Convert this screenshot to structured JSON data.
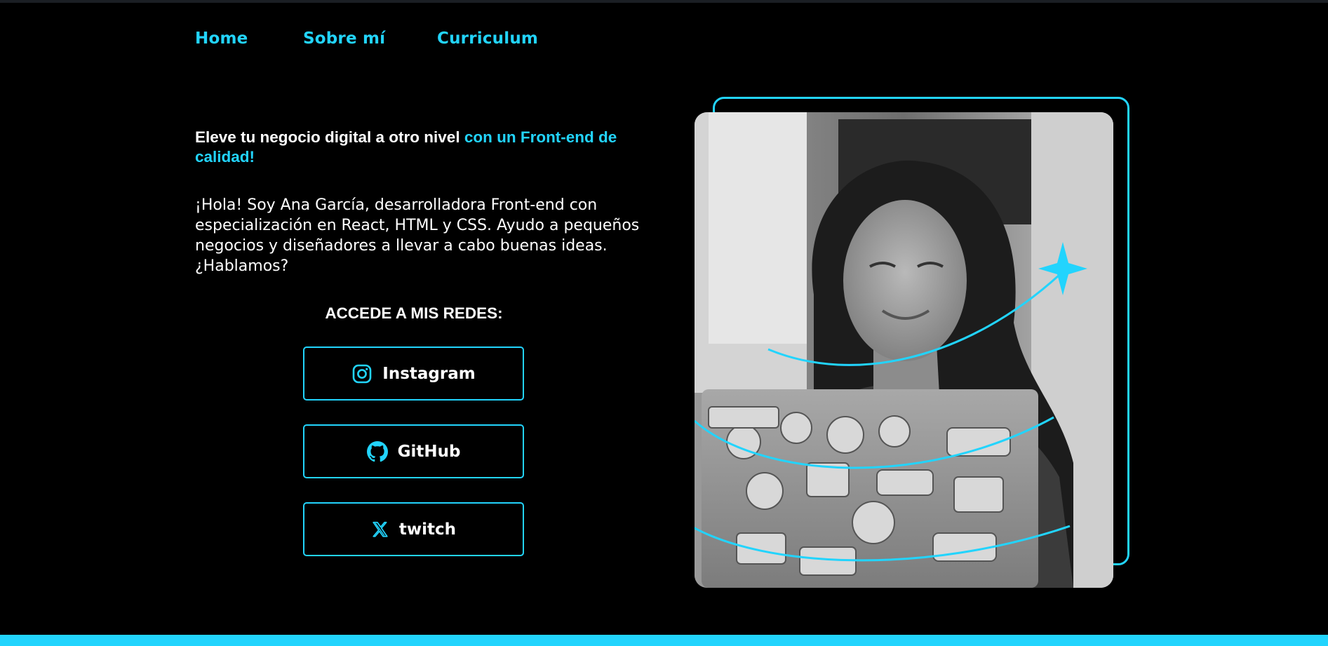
{
  "nav": {
    "items": [
      {
        "label": "Home"
      },
      {
        "label": "Sobre mí"
      },
      {
        "label": "Curriculum"
      }
    ]
  },
  "hero": {
    "headline_plain": "Eleve tu negocio digital a otro nivel ",
    "headline_accent": "con un Front-end de calidad!",
    "intro": "¡Hola! Soy Ana García, desarrolladora Front-end con especialización en React, HTML y CSS. Ayudo a pequeños negocios y diseñadores a llevar a cabo buenas ideas. ¿Hablamos?"
  },
  "social": {
    "title": "ACCEDE A MIS REDES:",
    "buttons": [
      {
        "label": "Instagram",
        "icon": "instagram-icon"
      },
      {
        "label": "GitHub",
        "icon": "github-icon"
      },
      {
        "label": "twitch",
        "icon": "x-icon"
      }
    ]
  },
  "colors": {
    "accent": "#22d4fd",
    "background": "#000000",
    "text": "#ffffff"
  }
}
